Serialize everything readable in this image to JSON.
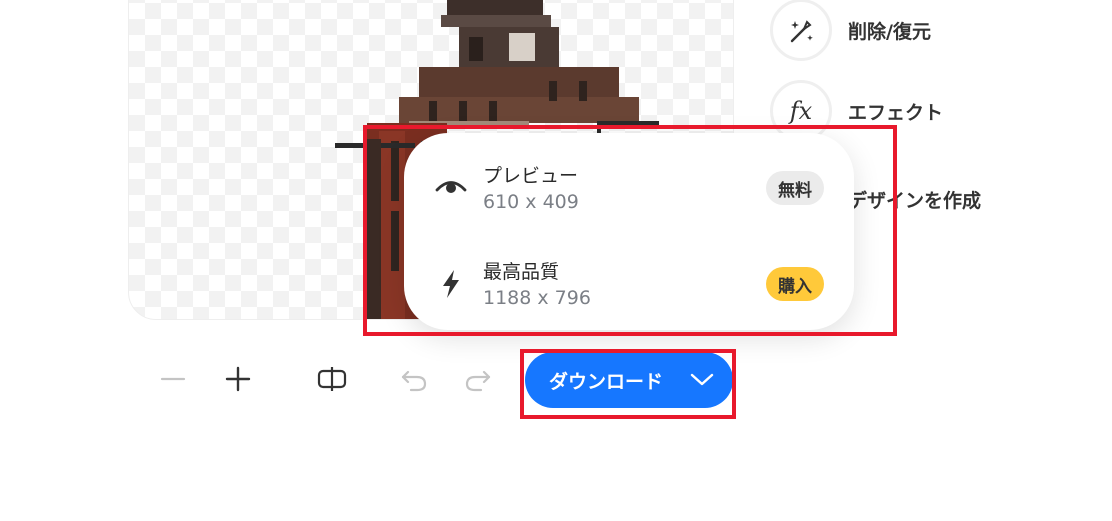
{
  "tools": [
    {
      "label": "削除/復元",
      "icon": "magic-wand-icon"
    },
    {
      "label": "エフェクト",
      "icon": "fx-icon",
      "glyph": "fx"
    },
    {
      "label": "デザインを作成",
      "icon": "design-icon"
    }
  ],
  "download_menu": {
    "options": [
      {
        "name": "プレビュー",
        "size": "610 x 409",
        "badge": "無料",
        "icon": "eye-icon"
      },
      {
        "name": "最高品質",
        "size": "1188 x 796",
        "badge": "購入",
        "icon": "lightning-icon"
      }
    ]
  },
  "toolbar": {
    "download_label": "ダウンロード"
  },
  "colors": {
    "accent": "#1677ff",
    "badge_buy": "#ffc93a",
    "badge_free": "#ebebeb",
    "highlight": "#e8192c"
  }
}
